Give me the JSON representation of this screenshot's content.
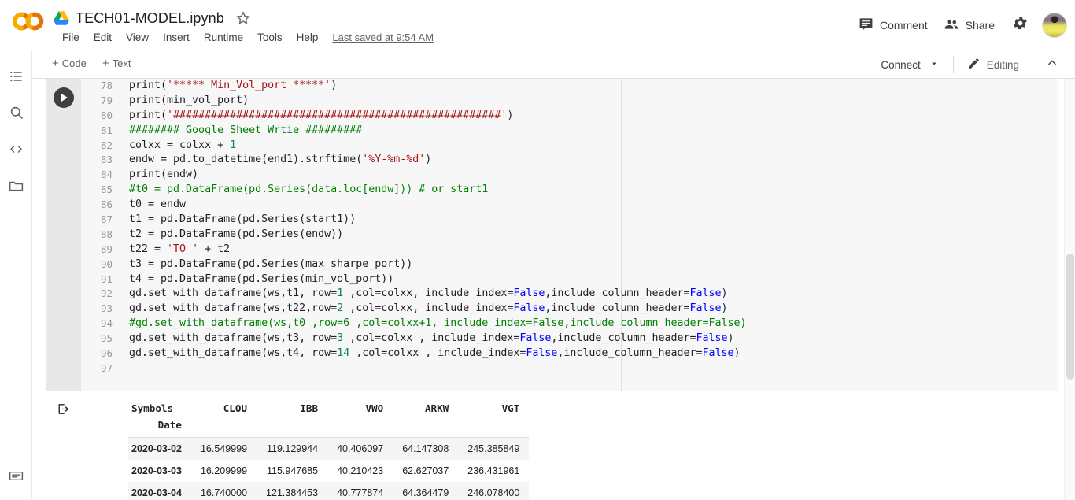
{
  "app": {
    "logo": "colab-logo",
    "doc_icon": "google-drive-icon",
    "doc_title": "TECH01-MODEL.ipynb",
    "star_icon": "star-outline-icon"
  },
  "menubar": {
    "items": [
      {
        "label": "File"
      },
      {
        "label": "Edit"
      },
      {
        "label": "View"
      },
      {
        "label": "Insert"
      },
      {
        "label": "Runtime"
      },
      {
        "label": "Tools"
      },
      {
        "label": "Help"
      }
    ],
    "saved_note": "Last saved at 9:54 AM"
  },
  "header_actions": {
    "comment_label": "Comment",
    "comment_icon": "comment-icon",
    "share_label": "Share",
    "share_icon": "people-icon",
    "settings_icon": "gear-icon",
    "avatar": "user-avatar"
  },
  "toolbar": {
    "add_code_label": "Code",
    "add_text_label": "Text",
    "plus": "+",
    "connect_label": "Connect",
    "connect_caret": "chevron-down-icon",
    "editing_label": "Editing",
    "editing_icon": "pencil-icon",
    "collapse_icon": "chevron-up-icon"
  },
  "rail": {
    "items": [
      {
        "name": "table-of-contents-icon"
      },
      {
        "name": "search-icon"
      },
      {
        "name": "code-snippets-icon"
      },
      {
        "name": "files-icon"
      }
    ],
    "bottom": {
      "name": "terminal-icon"
    }
  },
  "cell": {
    "run_icon": "play-icon",
    "output_icon": "output-arrow-icon",
    "first_line_number": 78,
    "lines": [
      {
        "n": 78,
        "tokens": [
          {
            "t": "plain",
            "v": "print("
          },
          {
            "t": "str",
            "v": "'***** Min_Vol_port *****'"
          },
          {
            "t": "plain",
            "v": ")"
          }
        ]
      },
      {
        "n": 79,
        "tokens": [
          {
            "t": "plain",
            "v": "print(min_vol_port)"
          }
        ]
      },
      {
        "n": 80,
        "tokens": [
          {
            "t": "plain",
            "v": "print("
          },
          {
            "t": "str",
            "v": "'####################################################'"
          },
          {
            "t": "plain",
            "v": ")"
          }
        ]
      },
      {
        "n": 81,
        "tokens": [
          {
            "t": "com",
            "v": "######## Google Sheet Wrtie #########"
          }
        ]
      },
      {
        "n": 82,
        "tokens": [
          {
            "t": "plain",
            "v": "colxx = colxx + "
          },
          {
            "t": "num",
            "v": "1"
          }
        ]
      },
      {
        "n": 83,
        "tokens": [
          {
            "t": "plain",
            "v": "endw = pd.to_datetime(end1).strftime("
          },
          {
            "t": "str",
            "v": "'%Y-%m-%d'"
          },
          {
            "t": "plain",
            "v": ")"
          }
        ]
      },
      {
        "n": 84,
        "tokens": [
          {
            "t": "plain",
            "v": "print(endw)"
          }
        ]
      },
      {
        "n": 85,
        "tokens": [
          {
            "t": "com",
            "v": "#t0 = pd.DataFrame(pd.Series(data.loc[endw])) # or start1"
          }
        ]
      },
      {
        "n": 86,
        "tokens": [
          {
            "t": "plain",
            "v": "t0 = endw"
          }
        ]
      },
      {
        "n": 87,
        "tokens": [
          {
            "t": "plain",
            "v": "t1 = pd.DataFrame(pd.Series(start1))"
          }
        ]
      },
      {
        "n": 88,
        "tokens": [
          {
            "t": "plain",
            "v": "t2 = pd.DataFrame(pd.Series(endw))"
          }
        ]
      },
      {
        "n": 89,
        "tokens": [
          {
            "t": "plain",
            "v": "t22 = "
          },
          {
            "t": "str",
            "v": "'TO '"
          },
          {
            "t": "plain",
            "v": " + t2"
          }
        ]
      },
      {
        "n": 90,
        "tokens": [
          {
            "t": "plain",
            "v": "t3 = pd.DataFrame(pd.Series(max_sharpe_port))"
          }
        ]
      },
      {
        "n": 91,
        "tokens": [
          {
            "t": "plain",
            "v": "t4 = pd.DataFrame(pd.Series(min_vol_port))"
          }
        ]
      },
      {
        "n": 92,
        "tokens": [
          {
            "t": "plain",
            "v": "gd.set_with_dataframe(ws,t1, row="
          },
          {
            "t": "num",
            "v": "1"
          },
          {
            "t": "plain",
            "v": " ,col=colxx, include_index="
          },
          {
            "t": "kw",
            "v": "False"
          },
          {
            "t": "plain",
            "v": ",include_column_header="
          },
          {
            "t": "kw",
            "v": "False"
          },
          {
            "t": "plain",
            "v": ")"
          }
        ]
      },
      {
        "n": 93,
        "tokens": [
          {
            "t": "plain",
            "v": "gd.set_with_dataframe(ws,t22,row="
          },
          {
            "t": "num",
            "v": "2"
          },
          {
            "t": "plain",
            "v": " ,col=colxx, include_index="
          },
          {
            "t": "kw",
            "v": "False"
          },
          {
            "t": "plain",
            "v": ",include_column_header="
          },
          {
            "t": "kw",
            "v": "False"
          },
          {
            "t": "plain",
            "v": ")"
          }
        ]
      },
      {
        "n": 94,
        "tokens": [
          {
            "t": "com",
            "v": "#gd.set_with_dataframe(ws,t0 ,row=6 ,col=colxx+1, include_index=False,include_column_header=False)"
          }
        ]
      },
      {
        "n": 95,
        "tokens": [
          {
            "t": "plain",
            "v": "gd.set_with_dataframe(ws,t3, row="
          },
          {
            "t": "num",
            "v": "3"
          },
          {
            "t": "plain",
            "v": " ,col=colxx , include_index="
          },
          {
            "t": "kw",
            "v": "False"
          },
          {
            "t": "plain",
            "v": ",include_column_header="
          },
          {
            "t": "kw",
            "v": "False"
          },
          {
            "t": "plain",
            "v": ")"
          }
        ]
      },
      {
        "n": 96,
        "tokens": [
          {
            "t": "plain",
            "v": "gd.set_with_dataframe(ws,t4, row="
          },
          {
            "t": "num",
            "v": "14"
          },
          {
            "t": "plain",
            "v": " ,col=colxx , include_index="
          },
          {
            "t": "kw",
            "v": "False"
          },
          {
            "t": "plain",
            "v": ",include_column_header="
          },
          {
            "t": "kw",
            "v": "False"
          },
          {
            "t": "plain",
            "v": ")"
          }
        ]
      },
      {
        "n": 97,
        "tokens": [
          {
            "t": "plain",
            "v": ""
          }
        ]
      }
    ]
  },
  "output_table": {
    "index_name": "Symbols",
    "index_sub": "Date",
    "columns": [
      "CLOU",
      "IBB",
      "VWO",
      "ARKW",
      "VGT"
    ],
    "rows": [
      {
        "date": "2020-03-02",
        "values": [
          "16.549999",
          "119.129944",
          "40.406097",
          "64.147308",
          "245.385849"
        ]
      },
      {
        "date": "2020-03-03",
        "values": [
          "16.209999",
          "115.947685",
          "40.210423",
          "62.627037",
          "236.431961"
        ]
      },
      {
        "date": "2020-03-04",
        "values": [
          "16.740000",
          "121.384453",
          "40.777874",
          "64.364479",
          "246.078400"
        ]
      }
    ]
  },
  "colors": {
    "accent": "#f9ab00",
    "cell_bg": "#f7f7f7",
    "gutter_bg": "#e8e8e8",
    "string": "#a31515",
    "comment": "#008000",
    "keyword": "#0000ff",
    "number": "#098658"
  }
}
